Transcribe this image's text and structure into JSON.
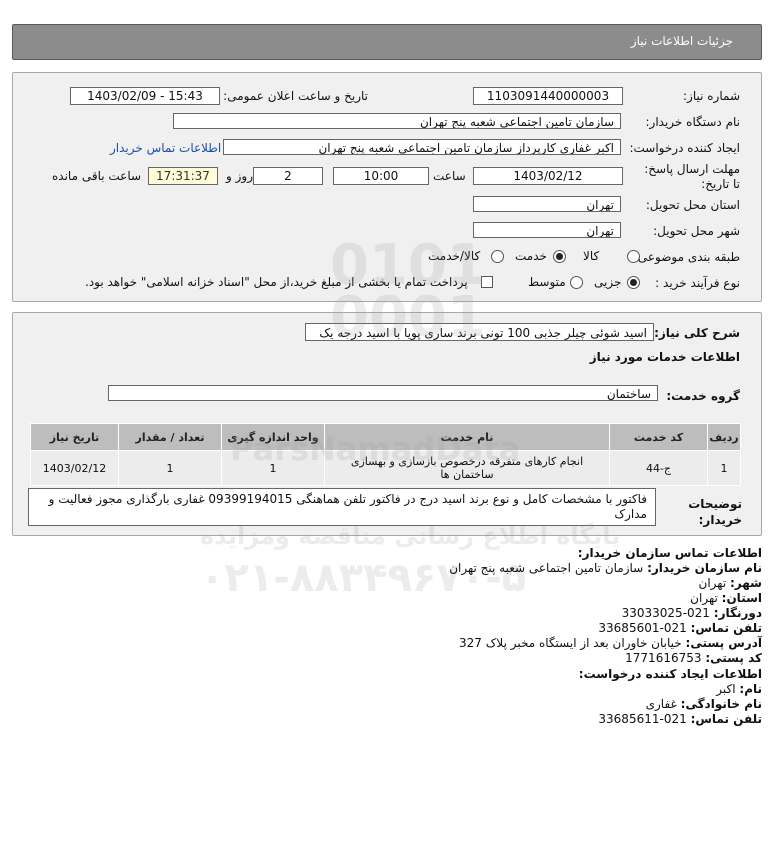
{
  "page": {
    "title": "جزئیات اطلاعات نیاز"
  },
  "form": {
    "need_number_label": "شماره نیاز:",
    "need_number": "1103091440000003",
    "announce_label": "تاریخ و ساعت اعلان عمومی:",
    "announce_value": "1403/02/09 - 15:43",
    "buyer_org_label": "نام دستگاه خریدار:",
    "buyer_org": "سازمان تامین اجتماعی شعبه پنج تهران",
    "creator_label": "ایجاد کننده درخواست:",
    "creator": "اکبر غفاری کارپرداز  سازمان تامین اجتماعی شعبه پنج تهران",
    "contact_link": "اطلاعات تماس خریدار",
    "deadline_label": "مهلت ارسال پاسخ: تا تاریخ:",
    "deadline_date": "1403/02/12",
    "time_label": "ساعت",
    "deadline_time": "10:00",
    "days_value": "2",
    "days_label": "روز و",
    "remaining_time": "17:31:37",
    "remaining_label": "ساعت باقی مانده",
    "province_label": "استان محل تحویل:",
    "province": "تهران",
    "city_label": "شهر محل تحویل:",
    "city": "تهران",
    "category_label": "طبقه بندی موضوعی:",
    "category_options": [
      "کالا",
      "خدمت",
      "کالا/خدمت"
    ],
    "process_label": "نوع فرآیند خرید :",
    "process_options": [
      "جزیی",
      "متوسط"
    ],
    "payment_note": "پرداخت تمام یا بخشی از مبلغ خرید،از محل \"اسناد خزانه اسلامی\" خواهد بود."
  },
  "details": {
    "summary_label": "شرح کلی نیاز:",
    "summary": "اسید شوئی چیلر جذبی 100 تونی برند ساری پویا با اسید درجه یک",
    "services_heading": "اطلاعات خدمات مورد نیاز",
    "service_group_label": "گروه خدمت:",
    "service_group": "ساختمان",
    "table": {
      "headers": [
        "ردیف",
        "کد خدمت",
        "نام خدمت",
        "واحد اندازه گیری",
        "تعداد / مقدار",
        "تاریخ نیاز"
      ],
      "rows": [
        [
          "1",
          "ج-44",
          "انجام کارهای متفرقه درخصوص بازسازی و بهسازی ساختمان ها",
          "1",
          "1",
          "1403/02/12"
        ]
      ]
    },
    "buyer_notes_label": "توضیحات خریدار:",
    "buyer_notes": "فاکتور با مشخصات کامل و نوع برند اسید درج در فاکتور تلفن هماهنگی 09399194015 غفاری بارگذاری مجوز فعالیت و مدارک"
  },
  "contact": {
    "buyer_heading": "اطلاعات تماس سازمان خریدار:",
    "org_label": "نام سازمان خریدار:",
    "org": "سازمان تامین اجتماعی شعبه پنج تهران",
    "city_label": "شهر:",
    "city": "تهران",
    "province_label": "استان:",
    "province": "تهران",
    "fax_label": "دورنگار:",
    "fax": "021-33033025",
    "phone_label": "تلفن تماس:",
    "phone": "021-33685601",
    "address_label": "آدرس پستی:",
    "address": "خیابان خاوران بعد از ایستگاه مخبر پلاک 327",
    "postal_label": "کد پستی:",
    "postal": "1771616753",
    "creator_heading": "اطلاعات ایجاد کننده درخواست:",
    "name_label": "نام:",
    "name": "اکبر",
    "family_label": "نام خانوادگی:",
    "family": "غفاری",
    "creator_phone_label": "تلفن تماس:",
    "creator_phone": "021-33685611"
  },
  "watermark": {
    "brand": "ParsNamadData",
    "tagline": "پایگاه اطلاع رسانی مناقصه ومزایده",
    "phone": "۰۲۱-۸۸۳۴۹۶۷۰-۵"
  }
}
